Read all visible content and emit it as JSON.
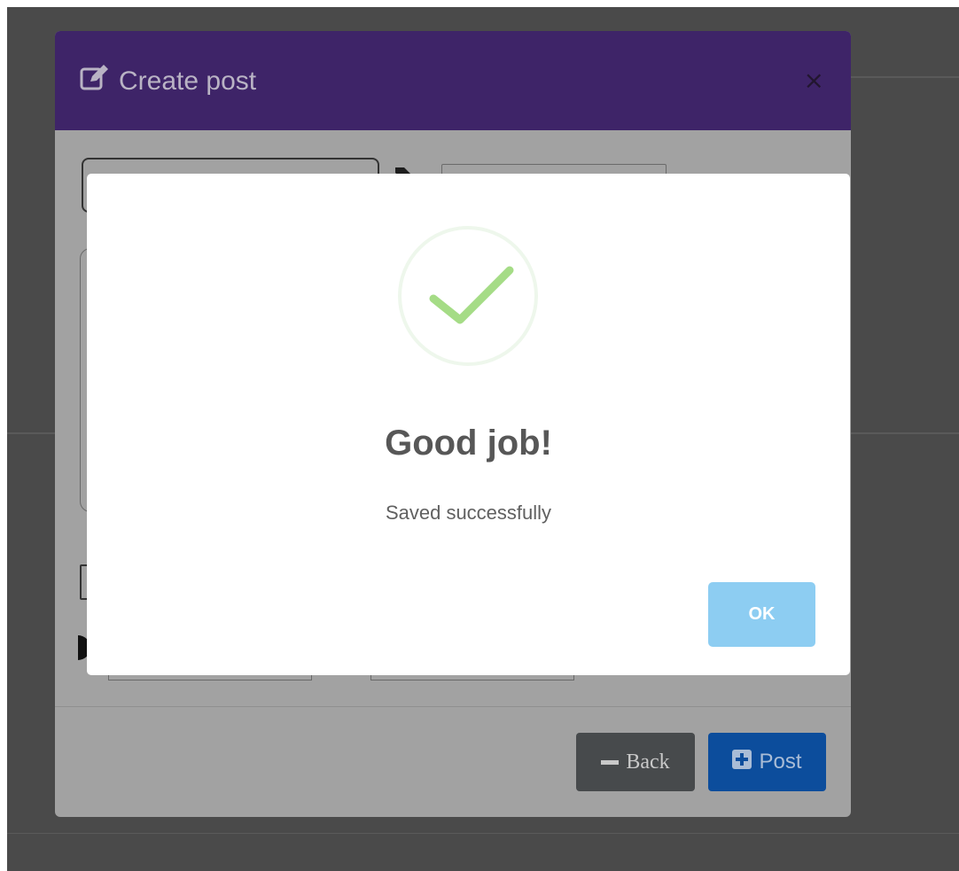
{
  "modal": {
    "title": "Create post",
    "close_label": "×",
    "icon": "edit-icon"
  },
  "footer": {
    "back_label": "Back",
    "post_label": "Post",
    "back_icon": "minus-icon",
    "post_icon": "plus-square-icon"
  },
  "dialog": {
    "title": "Good job!",
    "message": "Saved successfully",
    "ok_label": "OK",
    "icon": "check-icon",
    "accent_color": "#8dcdf2",
    "success_color": "#a5dc86"
  },
  "colors": {
    "header": "#3e2468",
    "back_button": "#474a4c",
    "post_button": "#0c4d9c"
  }
}
